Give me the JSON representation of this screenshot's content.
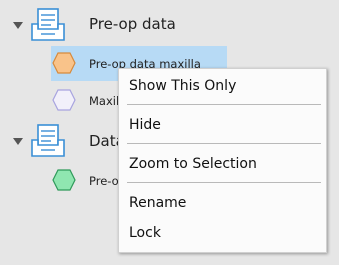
{
  "tree": {
    "groups": [
      {
        "label": "Pre-op data",
        "icon": "model-tray-icon",
        "items": [
          {
            "label": "Pre-op data maxilla",
            "icon": "hexagon-icon",
            "color": "#f9c38a",
            "selected": true
          },
          {
            "label": "Maxil",
            "icon": "hexagon-icon",
            "color": "#e8e6f6"
          }
        ]
      },
      {
        "label": "Data",
        "icon": "model-tray-icon",
        "items": [
          {
            "label": "Pre-o",
            "icon": "hexagon-icon",
            "color": "#8fe6b0"
          }
        ]
      }
    ]
  },
  "context_menu": {
    "items": [
      "Show This Only",
      "Hide",
      "Zoom to Selection",
      "Rename",
      "Lock"
    ]
  },
  "colors": {
    "background": "#e6e6e6",
    "selection": "#b7daf5",
    "tray_icon": "#3a8fd6"
  }
}
